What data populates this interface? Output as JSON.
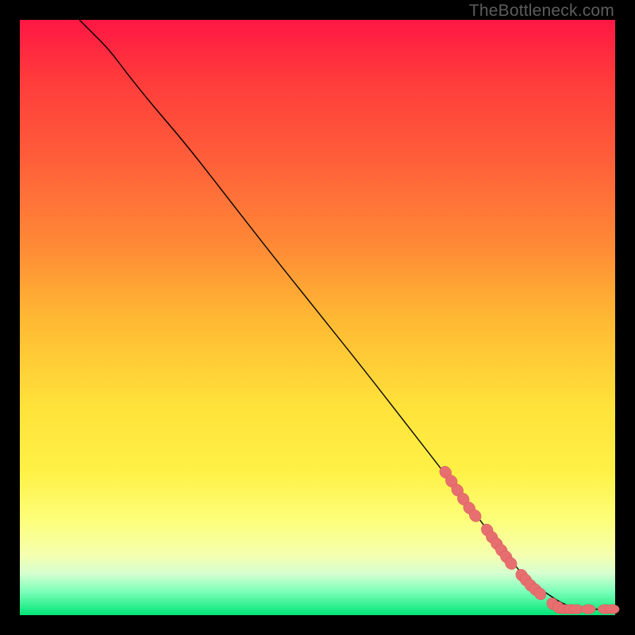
{
  "watermark": "TheBottleneck.com",
  "colors": {
    "curve_stroke": "#000000",
    "marker_fill": "#e76f6f",
    "marker_stroke": "#d85b5b"
  },
  "chart_data": {
    "type": "line",
    "title": "",
    "xlabel": "",
    "ylabel": "",
    "xlim": [
      0,
      100
    ],
    "ylim": [
      0,
      100
    ],
    "grid": false,
    "legend": false,
    "series": [
      {
        "name": "curve",
        "x": [
          10,
          12,
          15,
          18,
          22,
          28,
          35,
          42,
          50,
          58,
          65,
          72,
          78,
          82,
          85,
          88,
          91,
          93,
          95,
          97,
          99,
          100
        ],
        "y": [
          100,
          98,
          95,
          91,
          86,
          79,
          70,
          61,
          51,
          41,
          32,
          23,
          15,
          10,
          6,
          4,
          2,
          1.3,
          1,
          1,
          1,
          1
        ]
      }
    ],
    "markers": [
      {
        "x": 71.5,
        "y": 24.0,
        "kind": "blob"
      },
      {
        "x": 72.5,
        "y": 22.5,
        "kind": "blob"
      },
      {
        "x": 73.5,
        "y": 21.0,
        "kind": "blob"
      },
      {
        "x": 74.5,
        "y": 19.5,
        "kind": "blob"
      },
      {
        "x": 75.5,
        "y": 18.0,
        "kind": "blob"
      },
      {
        "x": 76.5,
        "y": 16.7,
        "kind": "blob"
      },
      {
        "x": 78.5,
        "y": 14.3,
        "kind": "blob"
      },
      {
        "x": 79.3,
        "y": 13.1,
        "kind": "blob"
      },
      {
        "x": 80.1,
        "y": 12.0,
        "kind": "blob"
      },
      {
        "x": 80.9,
        "y": 10.9,
        "kind": "blob"
      },
      {
        "x": 81.7,
        "y": 9.8,
        "kind": "blob"
      },
      {
        "x": 82.5,
        "y": 8.7,
        "kind": "blob"
      },
      {
        "x": 84.3,
        "y": 6.7,
        "kind": "blob"
      },
      {
        "x": 85.0,
        "y": 5.9,
        "kind": "blob"
      },
      {
        "x": 85.8,
        "y": 5.0,
        "kind": "blob"
      },
      {
        "x": 86.6,
        "y": 4.3,
        "kind": "blob"
      },
      {
        "x": 87.4,
        "y": 3.6,
        "kind": "blob"
      },
      {
        "x": 89.5,
        "y": 1.9,
        "kind": "blob"
      },
      {
        "x": 90.5,
        "y": 1.3,
        "kind": "blob"
      },
      {
        "x": 91.5,
        "y": 1.0,
        "kind": "blob"
      },
      {
        "x": 92.5,
        "y": 1.0,
        "kind": "blob"
      },
      {
        "x": 93.5,
        "y": 1.0,
        "kind": "blob"
      },
      {
        "x": 95.5,
        "y": 1.0,
        "kind": "blob"
      },
      {
        "x": 98.3,
        "y": 1.0,
        "kind": "blob"
      },
      {
        "x": 99.5,
        "y": 1.0,
        "kind": "blob"
      }
    ]
  }
}
